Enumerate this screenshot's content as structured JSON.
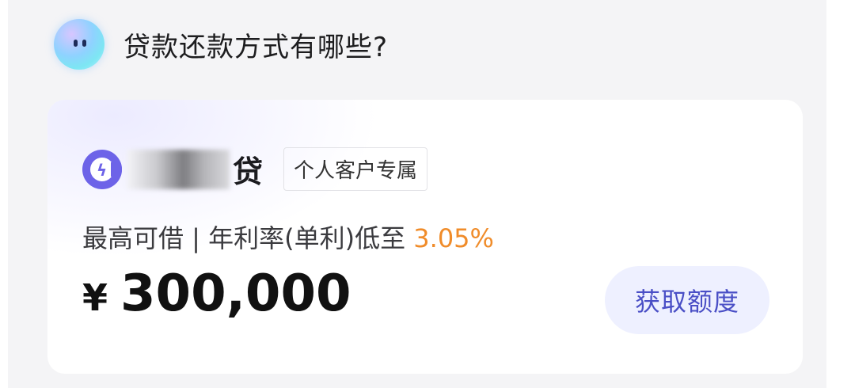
{
  "assistant": {
    "avatar_icon": "assistant-avatar-icon",
    "question": "贷款还款方式有哪些?"
  },
  "loan_card": {
    "brand": {
      "logo_icon": "brand-lightning-logo-icon",
      "name_suffix": "贷"
    },
    "tag": "个人客户专属",
    "rate_prefix": "最高可借 | 年利率(单利)低至",
    "rate_value": "3.05%",
    "currency_symbol": "¥",
    "amount": "300,000",
    "cta_label": "获取额度"
  },
  "colors": {
    "accent_orange": "#f08c2a",
    "brand_purple": "#6d63e8",
    "cta_bg": "#eef0ff",
    "cta_text": "#4a4fc6"
  }
}
